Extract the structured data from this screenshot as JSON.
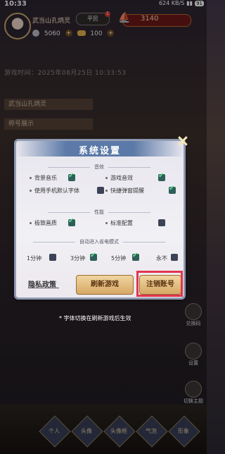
{
  "status_bar": {
    "time": "10:33",
    "network": "624 KB/S",
    "battery": "91"
  },
  "player": {
    "name": "武当山孔炳灵",
    "rank": "平民",
    "rank_badge_count": "1",
    "gold_premium": "3140",
    "silver": "5060",
    "ingots": "100"
  },
  "game_time": "游戏时间：2025年08月25日 10:33:53",
  "left_panel": {
    "row1": "武当山孔炳灵",
    "row2": "称号展示"
  },
  "settings": {
    "title": "系统设置",
    "section_audio": "音效",
    "bg_music": "背景音乐",
    "game_sfx": "游戏音效",
    "use_phone_font": "使用手机默认字体",
    "quick_popup": "快捷弹窗提醒",
    "section_performance": "性能",
    "ultimate_quality": "极致画质",
    "standard_config": "标准配置",
    "section_power_saving": "自动进入省电模式",
    "power_1": "1分钟",
    "power_3": "3分钟",
    "power_5": "5分钟",
    "power_never": "永不",
    "privacy_policy": "隐私政策",
    "refresh_game": "刷新游戏",
    "cancel_account": "注销账号",
    "hint": "* 字体切换在刷新游戏后生效"
  },
  "states": {
    "bg_music": true,
    "game_sfx": true,
    "use_phone_font": false,
    "quick_popup": true,
    "ultimate_quality": true,
    "standard_config": false,
    "power_1": false,
    "power_3": true,
    "power_5": true,
    "power_never": false
  },
  "side_menu": [
    "兑换码",
    "设置",
    "切换主题"
  ],
  "bottom_tabs": [
    "个人",
    "头像",
    "头像框",
    "气泡",
    "形象"
  ],
  "colors": {
    "accent_red": "#e2354c",
    "check_green": "#5ce08a",
    "title_blue": "#5c7aa8"
  }
}
